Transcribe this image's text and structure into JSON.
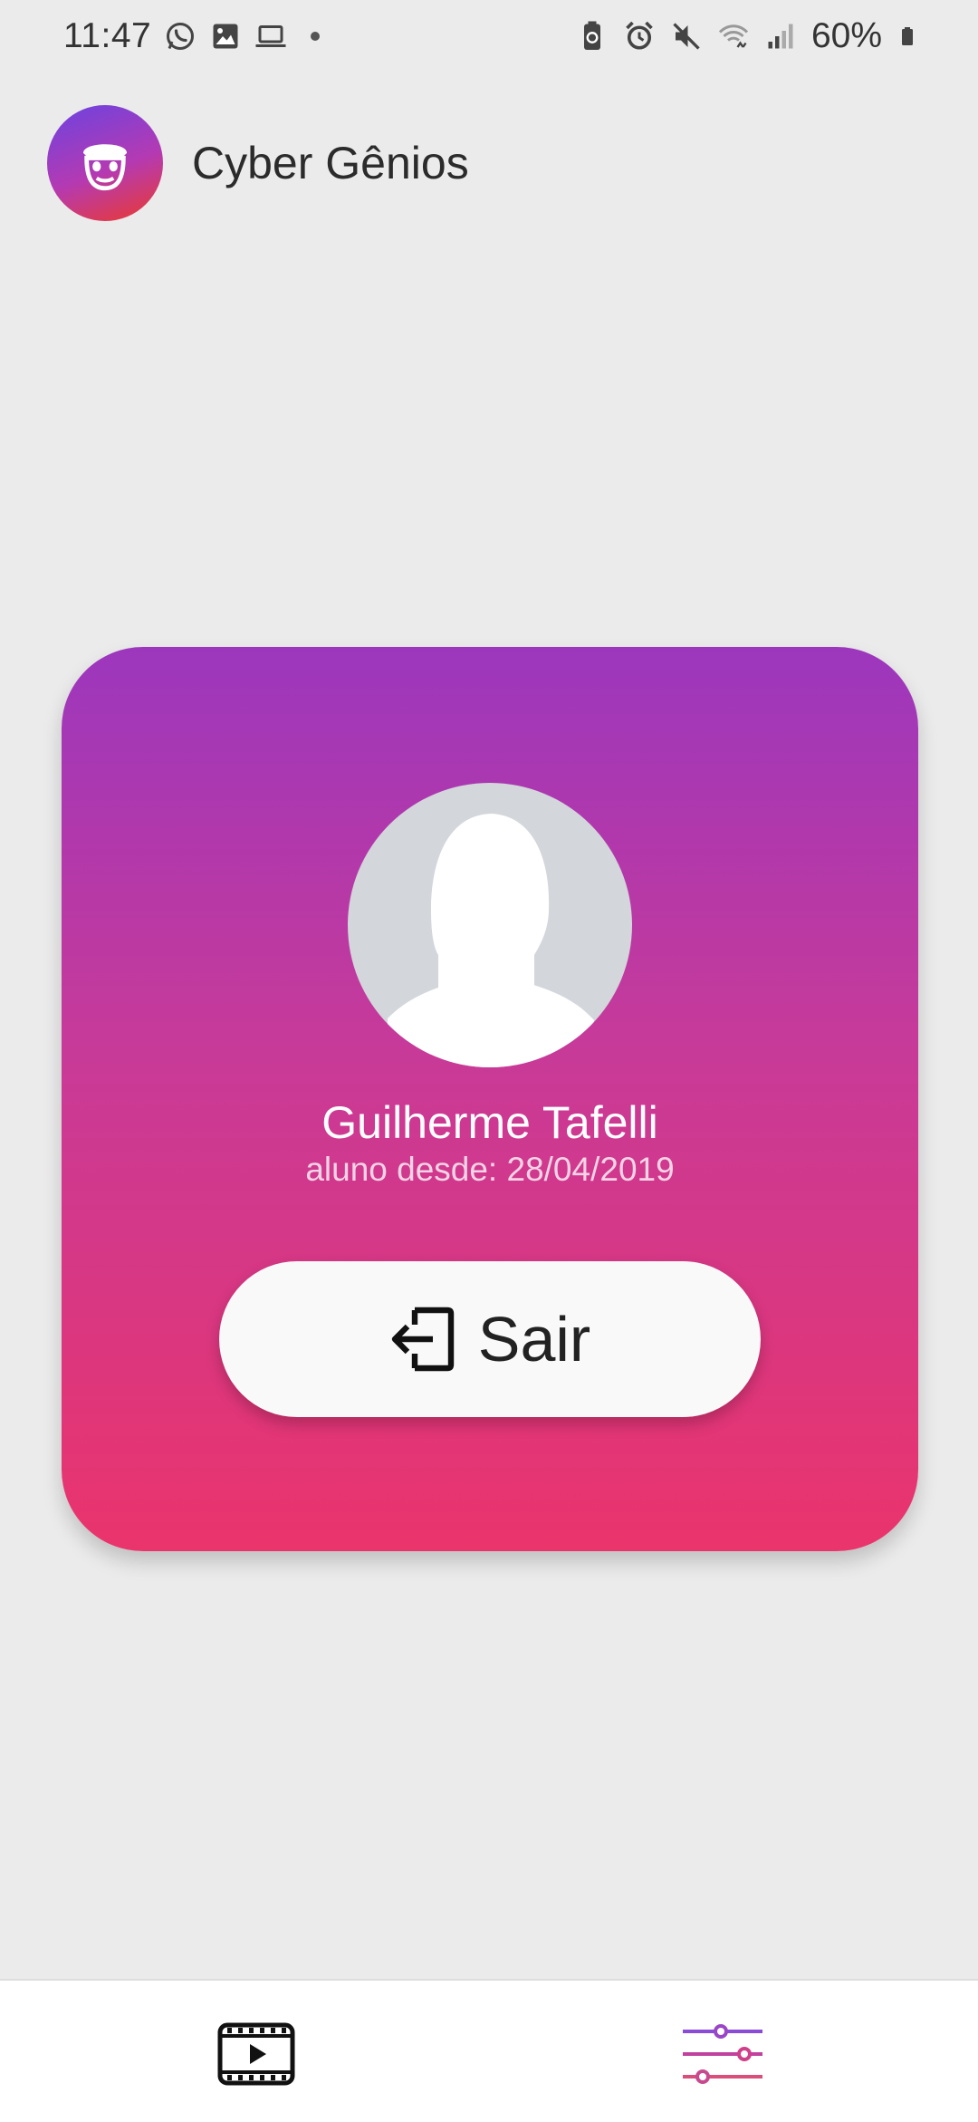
{
  "status_bar": {
    "time": "11:47",
    "battery": "60%",
    "left_icons": [
      "whatsapp-icon",
      "image-icon",
      "laptop-icon",
      "dot-icon"
    ],
    "right_icons": [
      "battery-saver-icon",
      "alarm-icon",
      "mute-icon",
      "wifi-icon",
      "signal-icon",
      "battery-icon"
    ]
  },
  "header": {
    "title": "Cyber Gênios",
    "logo_icon": "monkey-logo-icon"
  },
  "profile": {
    "name": "Guilherme Tafelli",
    "since": "aluno desde: 28/04/2019",
    "avatar_icon": "default-user-avatar-icon",
    "logout_label": "Sair",
    "logout_icon": "logout-icon"
  },
  "bottom_nav": {
    "items": [
      {
        "icon": "video-play-icon",
        "active": false
      },
      {
        "icon": "settings-sliders-icon",
        "active": true
      }
    ]
  },
  "colors": {
    "card_top": "#9c37bd",
    "card_bottom": "#ea346c",
    "background": "#ebebeb"
  }
}
